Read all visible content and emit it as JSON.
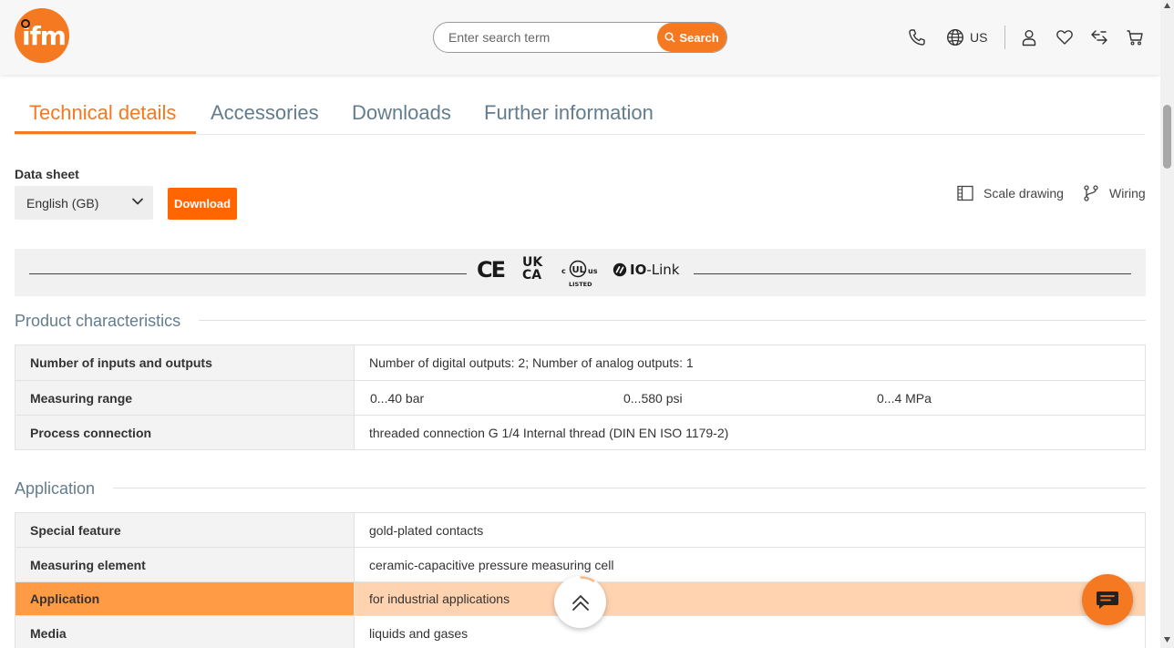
{
  "header": {
    "logo_text": "ifm",
    "search": {
      "placeholder": "Enter search term",
      "button_label": "Search"
    },
    "region_label": "US",
    "icons": [
      "phone-icon",
      "globe-icon",
      "user-icon",
      "heart-icon",
      "compare-icon",
      "cart-icon"
    ]
  },
  "tabs": [
    {
      "label": "Technical details",
      "active": true
    },
    {
      "label": "Accessories",
      "active": false
    },
    {
      "label": "Downloads",
      "active": false
    },
    {
      "label": "Further information",
      "active": false
    }
  ],
  "data_sheet": {
    "label": "Data sheet",
    "language": "English (GB)",
    "download_label": "Download"
  },
  "links": {
    "scale_drawing": "Scale drawing",
    "wiring": "Wiring"
  },
  "certifications": {
    "ce": "CE",
    "ukca_top": "UK",
    "ukca_bottom": "CA",
    "ul_c": "c",
    "ul_us": "us",
    "ul_mark": "UL",
    "ul_listed": "LISTED",
    "io_link_bold": "IO",
    "io_link_rest": "-Link"
  },
  "product_characteristics": {
    "title": "Product characteristics",
    "rows": [
      {
        "key": "Number of inputs and outputs",
        "value": "Number of digital outputs: 2; Number of analog outputs: 1"
      },
      {
        "key": "Measuring range",
        "values": [
          "0...40 bar",
          "0...580 psi",
          "0...4 MPa"
        ]
      },
      {
        "key": "Process connection",
        "value": "threaded connection G 1/4 Internal thread (DIN EN ISO 1179-2)"
      }
    ]
  },
  "application": {
    "title": "Application",
    "rows": [
      {
        "key": "Special feature",
        "value": "gold-plated contacts",
        "highlighted": false
      },
      {
        "key": "Measuring element",
        "value": "ceramic-capacitive pressure measuring cell",
        "highlighted": false
      },
      {
        "key": "Application",
        "value": "for industrial applications",
        "highlighted": true
      },
      {
        "key": "Media",
        "value": "liquids and gases",
        "highlighted": false
      }
    ]
  },
  "colors": {
    "brand_orange": "#f47920",
    "highlight_key": "#ff9a45",
    "highlight_value": "#ffd3b0",
    "tab_inactive": "#637c8e"
  }
}
